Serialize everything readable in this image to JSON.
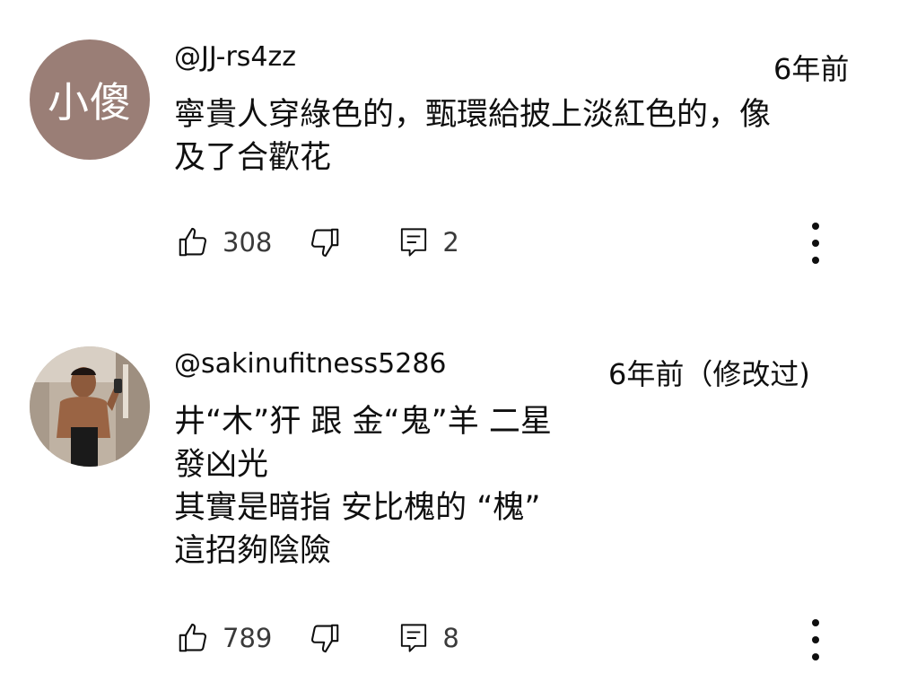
{
  "comments": [
    {
      "avatar_text": "小傻",
      "handle": "@JJ-rs4zz",
      "time": "6年前",
      "lines": [
        "寧貴人穿綠色的，甄環給披上淡紅色的，像",
        "及了合歡花"
      ],
      "likes": "308",
      "replies": "2"
    },
    {
      "avatar_text": "",
      "handle": "@sakinufitness5286",
      "time": "6年前（修改过)",
      "lines": [
        "井“木”犴  跟 金“鬼”羊 二星",
        "發凶光",
        "其實是暗指 安比槐的 “槐”",
        "這招夠陰險"
      ],
      "likes": "789",
      "replies": "8"
    }
  ],
  "icons": {
    "like": "thumbs-up-icon",
    "dislike": "thumbs-down-icon",
    "reply": "reply-icon",
    "more": "more-vertical-icon"
  },
  "colors": {
    "avatar_bg": "#9a7e76",
    "text": "#0f0f0f",
    "meta": "#3a3a3a"
  }
}
